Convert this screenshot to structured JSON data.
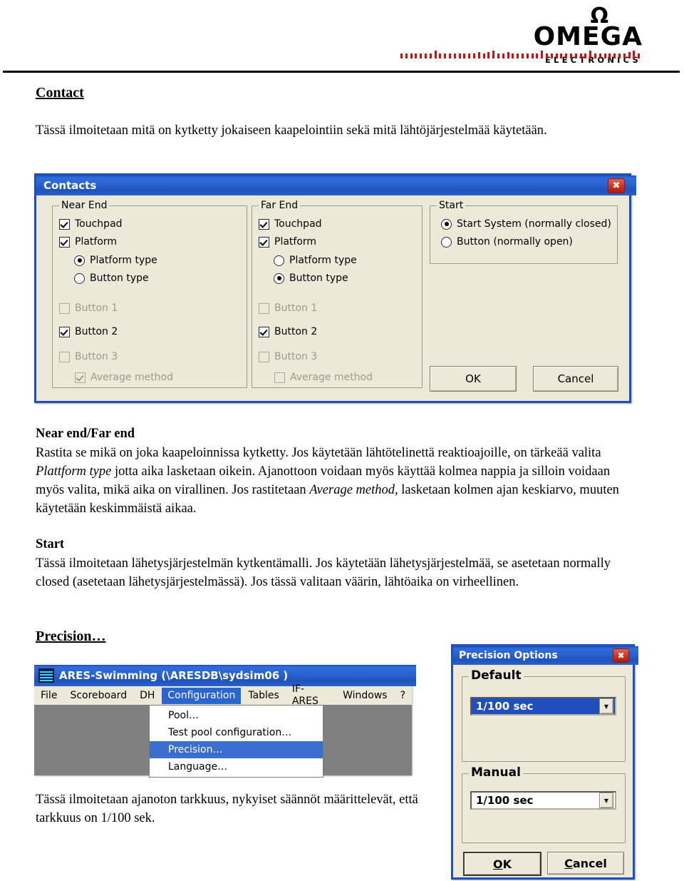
{
  "logo": {
    "omega_symbol": "Ω",
    "brand": "OMEGA",
    "subbrand": "ELECTRONICS",
    "accent_color": "#cc1111"
  },
  "document": {
    "heading_contact": "Contact",
    "intro": "Tässä ilmoitetaan mitä on kytketty jokaiseen kaapelointiin sekä mitä lähtöjärjestelmää käytetään.",
    "heading_nearfar": "Near end/Far end",
    "nearfar_p1": "Rastita se mikä on joka kaapeloinnissa kytketty. Jos käytetään lähtötelinettä reaktioajoille, on tärkeää valita ",
    "nearfar_em1": "Plattform type",
    "nearfar_p2": " jotta aika lasketaan oikein. Ajanottoon voidaan myös käyttää kolmea nappia ja silloin voidaan myös valita, mikä aika on virallinen. Jos rastitetaan ",
    "nearfar_em2": "Average method,",
    "nearfar_p3": " lasketaan kolmen ajan keskiarvo, muuten käytetään keskimmäistä aikaa.",
    "heading_start": "Start",
    "start_p": "Tässä ilmoitetaan lähetysjärjestelmän kytkentämalli. Jos käytetään lähetysjärjestelmää, se asetetaan normally closed (asetetaan lähetysjärjestelmässä). Jos tässä valitaan väärin, lähtöaika on virheellinen.",
    "heading_precision": "Precision…",
    "precision_p": "Tässä ilmoitetaan ajanoton tarkkuus, nykyiset säännöt määrittelevät, että tarkkuus on 1/100 sek."
  },
  "contacts_dialog": {
    "title": "Contacts",
    "close_glyph": "✖",
    "near_end": {
      "legend": "Near End",
      "touchpad": "Touchpad",
      "platform": "Platform",
      "platform_type": "Platform type",
      "button_type": "Button  type",
      "button1": "Button 1",
      "button2": "Button 2",
      "button3": "Button 3",
      "average_method": "Average method"
    },
    "far_end": {
      "legend": "Far End",
      "touchpad": "Touchpad",
      "platform": "Platform",
      "platform_type": "Platform type",
      "button_type": "Button  type",
      "button1": "Button 1",
      "button2": "Button 2",
      "button3": "Button 3",
      "average_method": "Average method"
    },
    "start": {
      "legend": "Start",
      "option_system": "Start System (normally closed)",
      "option_button": "Button (normally open)"
    },
    "ok_label": "OK",
    "cancel_label": "Cancel"
  },
  "ares_window": {
    "title": "ARES-Swimming (\\ARESDB\\sydsim06 )",
    "menu": [
      {
        "label": "File",
        "selected": false
      },
      {
        "label": "Scoreboard",
        "selected": false
      },
      {
        "label": "DH",
        "selected": false
      },
      {
        "label": "Configuration",
        "selected": true
      },
      {
        "label": "Tables",
        "selected": false
      },
      {
        "label": "IF-ARES",
        "selected": false
      },
      {
        "label": "Windows",
        "selected": false
      },
      {
        "label": "?",
        "selected": false
      }
    ],
    "dropdown": [
      {
        "label": "Pool…",
        "selected": false
      },
      {
        "label": "Test pool configuration…",
        "selected": false
      },
      {
        "label": "Precision…",
        "selected": true
      },
      {
        "label": "Language…",
        "selected": false
      }
    ]
  },
  "precision_dialog": {
    "title": "Precision Options",
    "close_glyph": "✖",
    "default_legend": "Default",
    "default_value": "1/100 sec",
    "manual_legend": "Manual",
    "manual_value": "1/100 sec",
    "ok_label": "OK",
    "cancel_label": "Cancel",
    "dropdown_arrow": "▼"
  }
}
